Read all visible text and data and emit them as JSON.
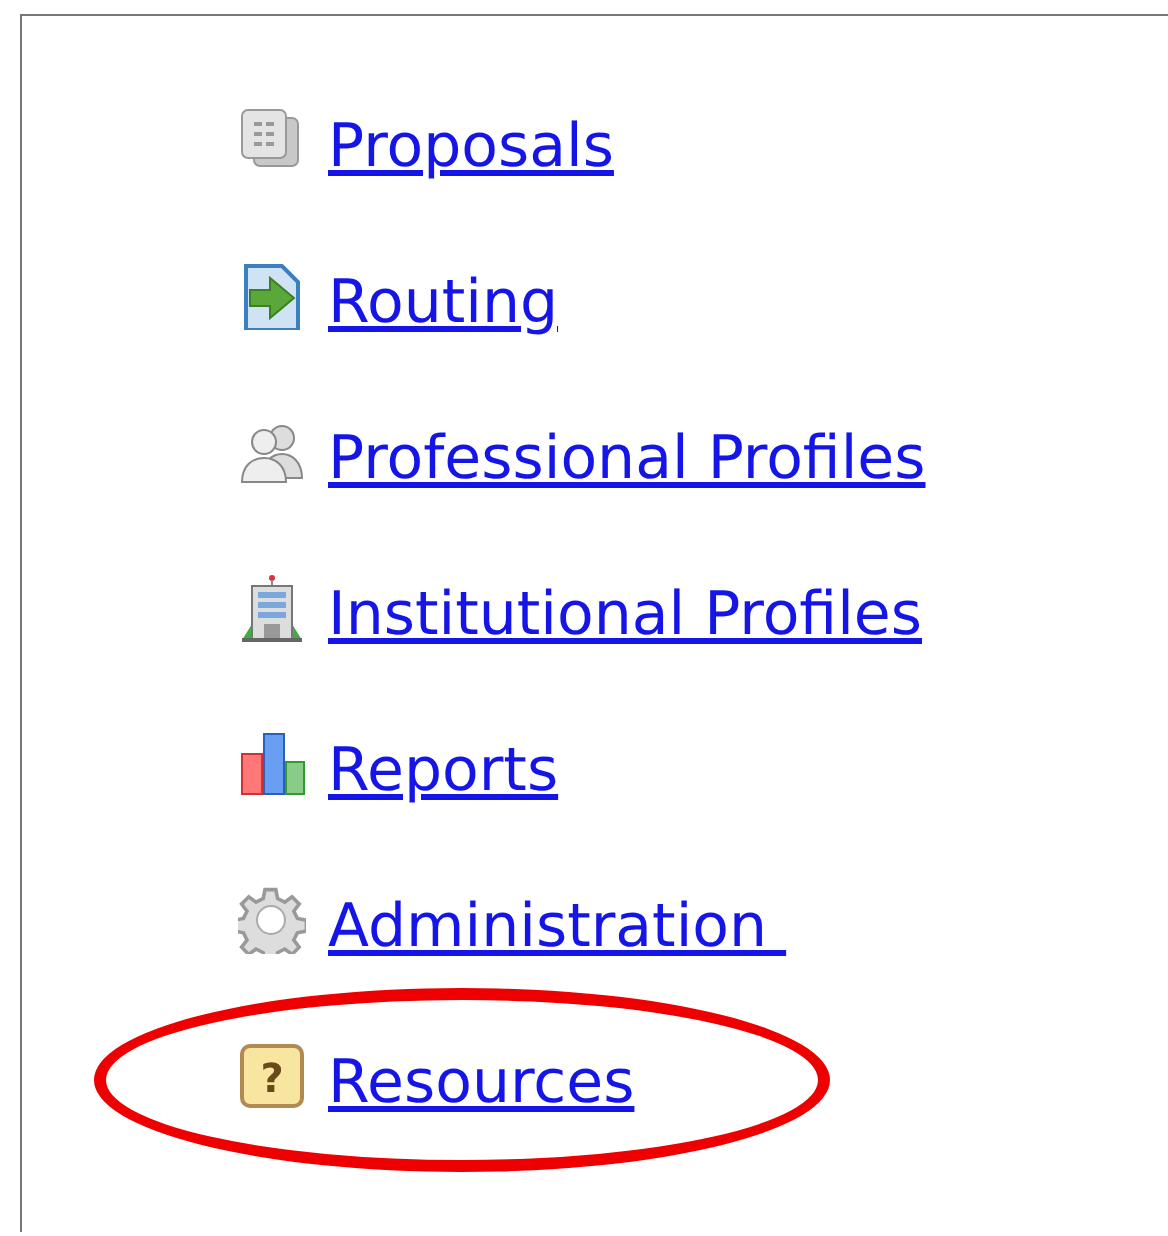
{
  "menu": [
    {
      "label": "Proposals",
      "kind": "documents",
      "circled": false
    },
    {
      "label": "Routing",
      "kind": "routing",
      "circled": false
    },
    {
      "label": "Professional Profiles",
      "kind": "people",
      "circled": false
    },
    {
      "label": "Institutional Profiles",
      "kind": "building",
      "circled": false
    },
    {
      "label": "Reports",
      "kind": "chart",
      "circled": false
    },
    {
      "label": "Administration ",
      "kind": "gear",
      "circled": false
    },
    {
      "label": "Resources",
      "kind": "help",
      "symbol": "?",
      "circled": true
    }
  ]
}
